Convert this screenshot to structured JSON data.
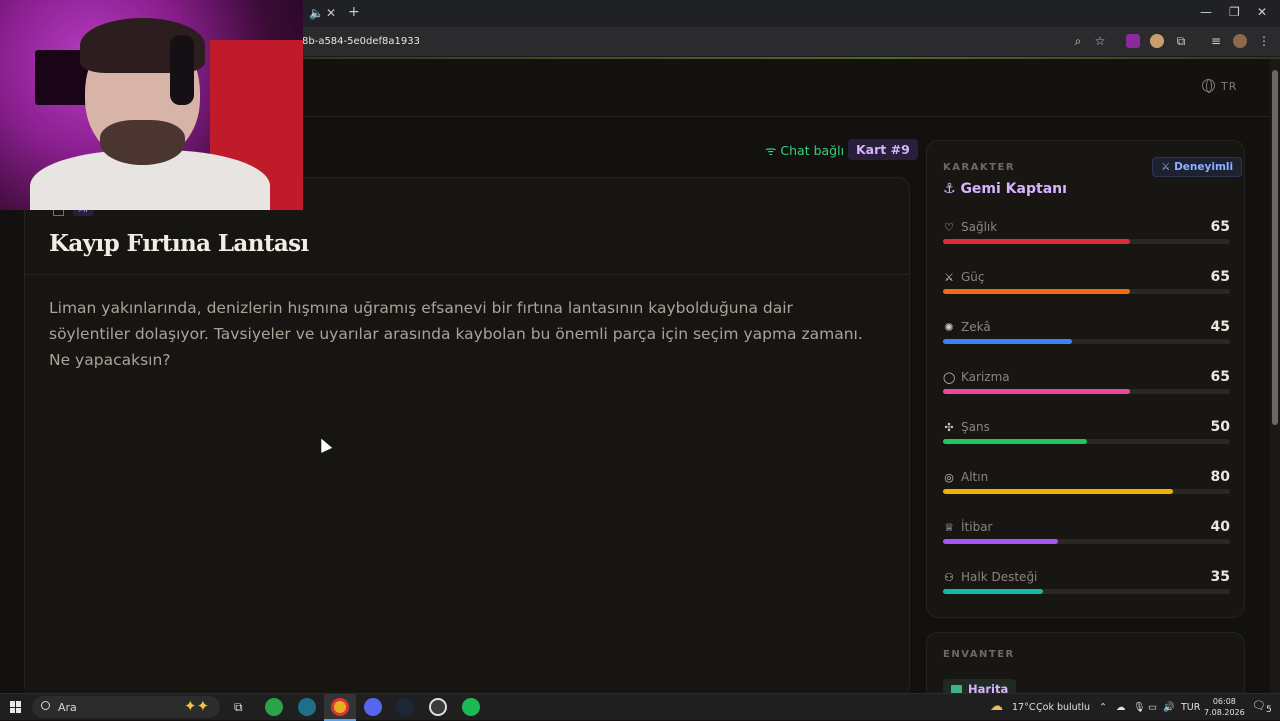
{
  "browser": {
    "url": "8b-a584-5e0def8a1933"
  },
  "header": {
    "language": "TR"
  },
  "status": {
    "chat": "Chat bağlı",
    "card_badge": "Kart #9"
  },
  "card": {
    "tag": "AI",
    "title": "Kayıp Fırtına Lantası",
    "body": "Liman yakınlarında, denizlerin hışmına uğramış efsanevi bir fırtına lantasının kaybolduğuna dair söylentiler dolaşıyor. Tavsiyeler ve uyarılar arasında kaybolan bu önemli parça için seçim yapma zamanı. Ne yapacaksın?"
  },
  "character": {
    "section_label": "KARAKTER",
    "level_badge": "Deneyimli",
    "name": "Gemi Kaptanı",
    "stats": [
      {
        "name": "Sağlık",
        "value": 65,
        "color": "#e0293b",
        "icon": "heart-icon"
      },
      {
        "name": "Güç",
        "value": 65,
        "color": "#f06a16",
        "icon": "sword-icon"
      },
      {
        "name": "Zekâ",
        "value": 45,
        "color": "#3b82f6",
        "icon": "brain-icon"
      },
      {
        "name": "Karizma",
        "value": 65,
        "color": "#ec4899",
        "icon": "chat-bubble-icon"
      },
      {
        "name": "Şans",
        "value": 50,
        "color": "#22c55e",
        "icon": "clover-icon"
      },
      {
        "name": "Altın",
        "value": 80,
        "color": "#eab308",
        "icon": "coins-icon"
      },
      {
        "name": "İtibar",
        "value": 40,
        "color": "#a855f7",
        "icon": "crown-icon"
      },
      {
        "name": "Halk Desteği",
        "value": 35,
        "color": "#14b8a6",
        "icon": "people-icon"
      }
    ]
  },
  "inventory": {
    "section_label": "ENVANTER",
    "items": [
      "Harita"
    ]
  },
  "taskbar": {
    "search": "Ara",
    "weather": "17°C",
    "weather_text": "Çok bulutlu",
    "lang": "TUR",
    "time": "06:08",
    "date": "7.08.2026",
    "notif": "5"
  }
}
